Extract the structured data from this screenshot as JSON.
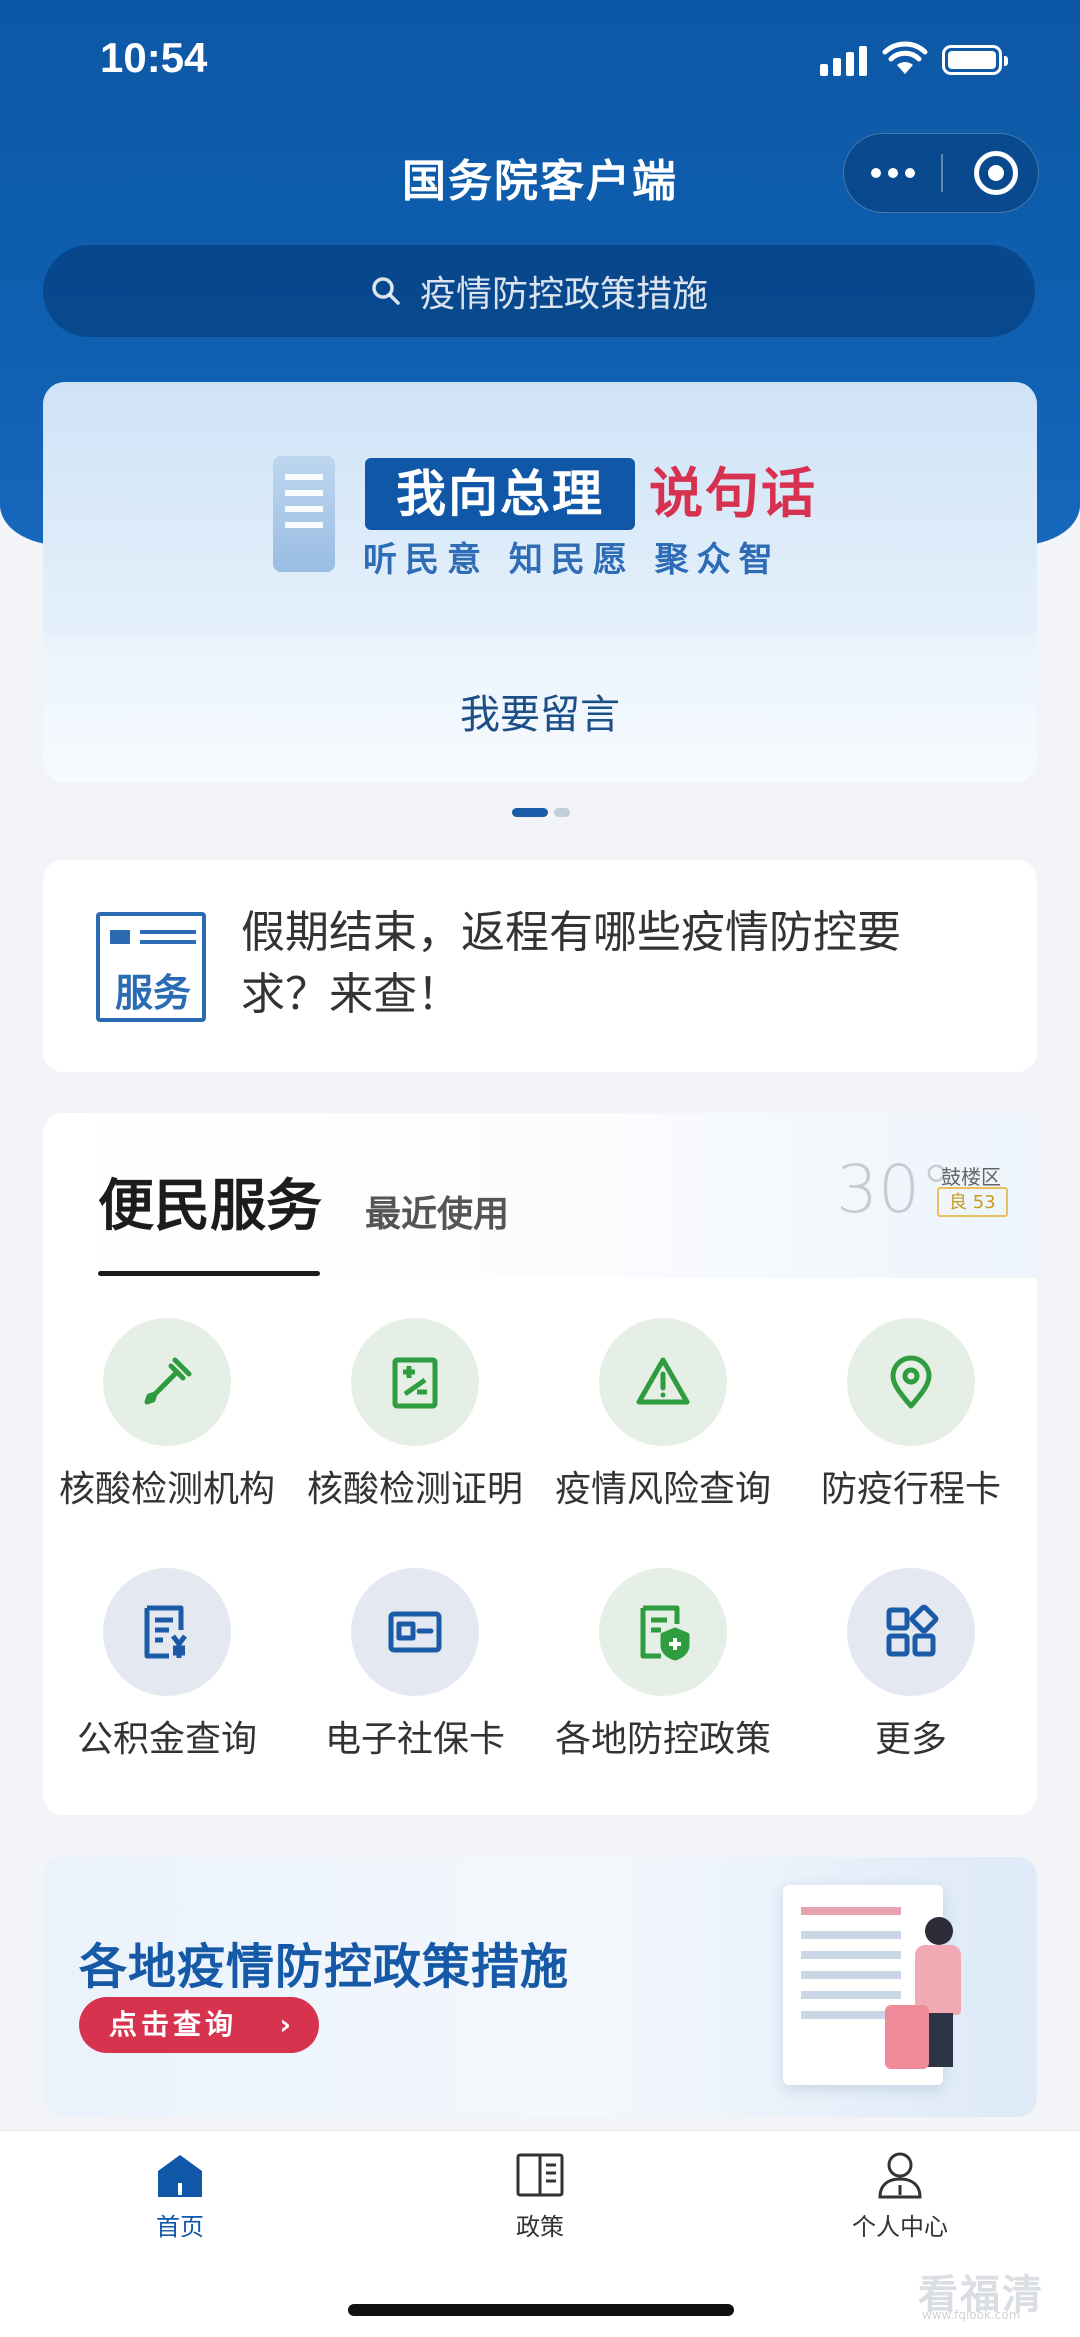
{
  "status_bar": {
    "time": "10:54"
  },
  "nav": {
    "title": "国务院客户端"
  },
  "search": {
    "placeholder": "疫情防控政策措施"
  },
  "banner": {
    "boxed_text": "我向总理",
    "red_text": "说句话",
    "subtitle": "听民意  知民愿  聚众智",
    "cta": "我要留言"
  },
  "notice": {
    "icon_text": "服务",
    "text": "假期结束，返程有哪些疫情防控要求？来查！"
  },
  "services": {
    "tab_active": "便民服务",
    "tab_recent": "最近使用",
    "weather": {
      "temp": "30°",
      "area": "鼓楼区",
      "aqi": "良 53"
    },
    "items": [
      {
        "label": "核酸检测机构",
        "icon": "dropper-icon",
        "tone": "green"
      },
      {
        "label": "核酸检测证明",
        "icon": "certificate-icon",
        "tone": "green"
      },
      {
        "label": "疫情风险查询",
        "icon": "warning-icon",
        "tone": "green"
      },
      {
        "label": "防疫行程卡",
        "icon": "location-pin-icon",
        "tone": "green"
      },
      {
        "label": "公积金查询",
        "icon": "fund-receipt-icon",
        "tone": "blue"
      },
      {
        "label": "电子社保卡",
        "icon": "id-card-icon",
        "tone": "blue"
      },
      {
        "label": "各地防控政策",
        "icon": "shield-doc-icon",
        "tone": "green"
      },
      {
        "label": "更多",
        "icon": "grid-more-icon",
        "tone": "blue"
      }
    ]
  },
  "policy_banner": {
    "title": "各地疫情防控政策措施",
    "button": "点击查询"
  },
  "tabbar": {
    "items": [
      {
        "label": "首页",
        "icon": "home-icon",
        "active": true
      },
      {
        "label": "政策",
        "icon": "book-icon",
        "active": false
      },
      {
        "label": "个人中心",
        "icon": "user-icon",
        "active": false
      }
    ]
  },
  "watermark": {
    "text": "看福清",
    "url": "www.fqlook.com"
  },
  "colors": {
    "primary": "#0f5fb0",
    "accent_red": "#d7334f",
    "icon_green": "#2e9c3f",
    "icon_blue": "#1a5aa6"
  }
}
